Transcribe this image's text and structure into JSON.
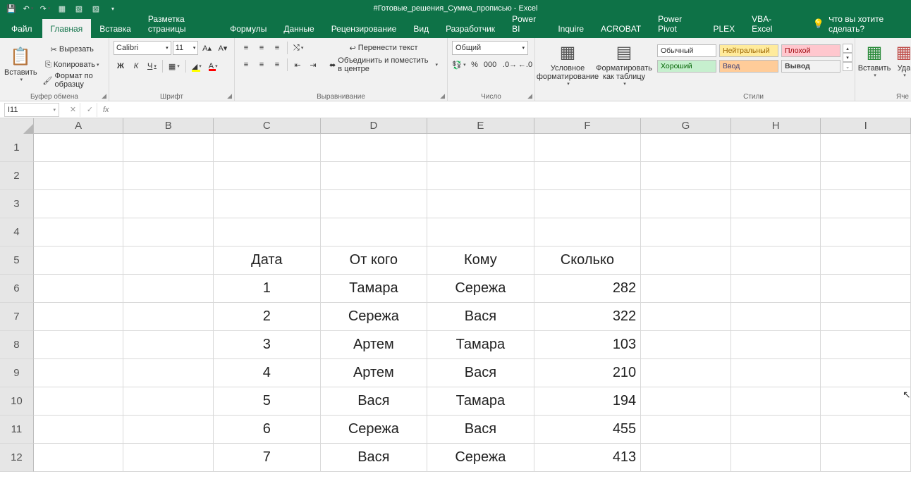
{
  "title": "#Готовые_решения_Сумма_прописью - Excel",
  "tabs": {
    "file": "Файл",
    "home": "Главная",
    "insert": "Вставка",
    "layout": "Разметка страницы",
    "formulas": "Формулы",
    "data": "Данные",
    "review": "Рецензирование",
    "view": "Вид",
    "developer": "Разработчик",
    "powerbi": "Power BI",
    "inquire": "Inquire",
    "acrobat": "ACROBAT",
    "powerpivot": "Power Pivot",
    "plex": "PLEX",
    "vbaexcel": "VBA-Excel"
  },
  "tell_me": "Что вы хотите сделать?",
  "ribbon": {
    "clipboard": {
      "paste": "Вставить",
      "cut": "Вырезать",
      "copy": "Копировать",
      "format_painter": "Формат по образцу",
      "label": "Буфер обмена"
    },
    "font": {
      "name": "Calibri",
      "size": "11",
      "label": "Шрифт",
      "bold": "Ж",
      "italic": "К",
      "underline": "Ч"
    },
    "alignment": {
      "wrap": "Перенести текст",
      "merge": "Объединить и поместить в центре",
      "label": "Выравнивание"
    },
    "number": {
      "format": "Общий",
      "label": "Число"
    },
    "cond_format": "Условное форматирование",
    "format_table": "Форматировать как таблицу",
    "styles": {
      "normal": "Обычный",
      "neutral": "Нейтральный",
      "bad": "Плохой",
      "good": "Хороший",
      "input": "Ввод",
      "output": "Вывод",
      "label": "Стили"
    },
    "cells": {
      "insert": "Вставить",
      "delete": "Уда",
      "label": "Яче"
    }
  },
  "name_box": "I11",
  "columns": [
    "A",
    "B",
    "C",
    "D",
    "E",
    "F",
    "G",
    "H",
    "I"
  ],
  "row_numbers": [
    1,
    2,
    3,
    4,
    5,
    6,
    7,
    8,
    9,
    10,
    11,
    12
  ],
  "sheet": {
    "headers": {
      "C": "Дата",
      "D": "От кого",
      "E": "Кому",
      "F": "Сколько"
    },
    "rows": [
      {
        "C": "1",
        "D": "Тамара",
        "E": "Сережа",
        "F": "282"
      },
      {
        "C": "2",
        "D": "Сережа",
        "E": "Вася",
        "F": "322"
      },
      {
        "C": "3",
        "D": "Артем",
        "E": "Тамара",
        "F": "103"
      },
      {
        "C": "4",
        "D": "Артем",
        "E": "Вася",
        "F": "210"
      },
      {
        "C": "5",
        "D": "Вася",
        "E": "Тамара",
        "F": "194"
      },
      {
        "C": "6",
        "D": "Сережа",
        "E": "Вася",
        "F": "455"
      },
      {
        "C": "7",
        "D": "Вася",
        "E": "Сережа",
        "F": "413"
      }
    ]
  }
}
